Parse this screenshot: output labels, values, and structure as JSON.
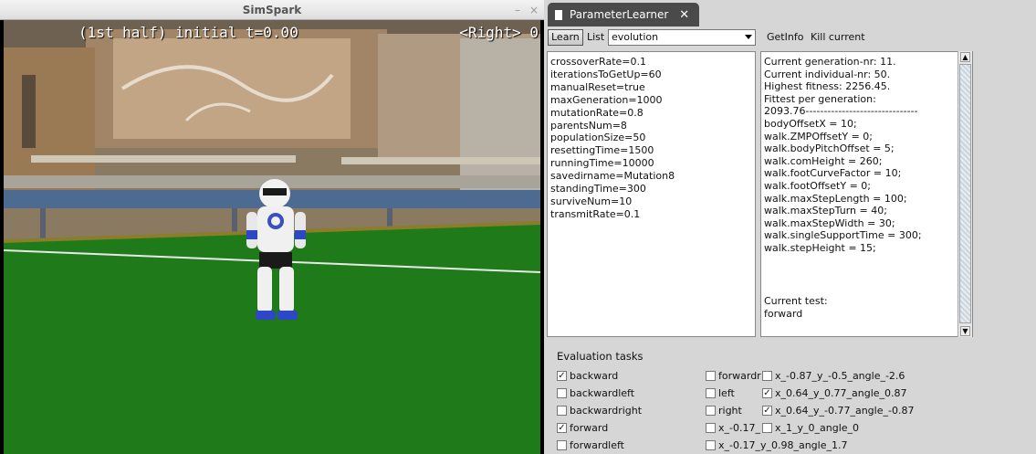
{
  "simspark": {
    "title": "SimSpark",
    "controls": [
      "–",
      "×"
    ],
    "hud_left": "(1st half) initial t=0.00",
    "hud_right": "<Right> 0"
  },
  "tab": {
    "label": "ParameterLearner",
    "close": "✕"
  },
  "toolbar": {
    "learn_label": "Learn",
    "list_label": "List",
    "list_value": "evolution",
    "getinfo_label": "GetInfo",
    "kill_label": "Kill current"
  },
  "params": [
    "crossoverRate=0.1",
    "iterationsToGetUp=60",
    "manualReset=true",
    "maxGeneration=1000",
    "mutationRate=0.8",
    "parentsNum=8",
    "populationSize=50",
    "resettingTime=1500",
    "runningTime=10000",
    "savedirname=Mutation8",
    "standingTime=300",
    "surviveNum=10",
    "transmitRate=0.1"
  ],
  "info": [
    "Current generation-nr: 11.",
    "Current individual-nr: 50.",
    "Highest fitness: 2256.45.",
    "Fittest per generation:",
    "2093.76-------------------------------",
    "bodyOffsetX = 10;",
    "walk.ZMPOffsetY = 0;",
    "walk.bodyPitchOffset = 5;",
    "walk.comHeight = 260;",
    "walk.footCurveFactor = 10;",
    "walk.footOffsetY = 0;",
    "walk.maxStepLength = 100;",
    "walk.maxStepTurn = 40;",
    "walk.maxStepWidth = 30;",
    "walk.singleSupportTime = 300;",
    "walk.stepHeight = 15;"
  ],
  "current_test_label": "Current test:",
  "current_test_value": "forward",
  "tasks_title": "Evaluation tasks",
  "tasks": [
    {
      "label": "backward",
      "checked": true
    },
    {
      "label": "backwardleft",
      "checked": false
    },
    {
      "label": "backwardright",
      "checked": false
    },
    {
      "label": "forward",
      "checked": true
    },
    {
      "label": "forwardleft",
      "checked": false
    },
    {
      "label": "forwardr",
      "checked": false
    },
    {
      "label": "left",
      "checked": false
    },
    {
      "label": "right",
      "checked": false
    },
    {
      "label": "x_-0.17_",
      "checked": false
    },
    {
      "label": "x_-0.17_y_0.98_angle_1.7",
      "checked": false
    },
    {
      "label": "x_-0.87_y_-0.5_angle_-2.6",
      "checked": false
    },
    {
      "label": "x_0.64_y_0.77_angle_0.87",
      "checked": true
    },
    {
      "label": "x_0.64_y_-0.77_angle_-0.87",
      "checked": true
    },
    {
      "label": "x_1_y_0_angle_0",
      "checked": false
    }
  ]
}
